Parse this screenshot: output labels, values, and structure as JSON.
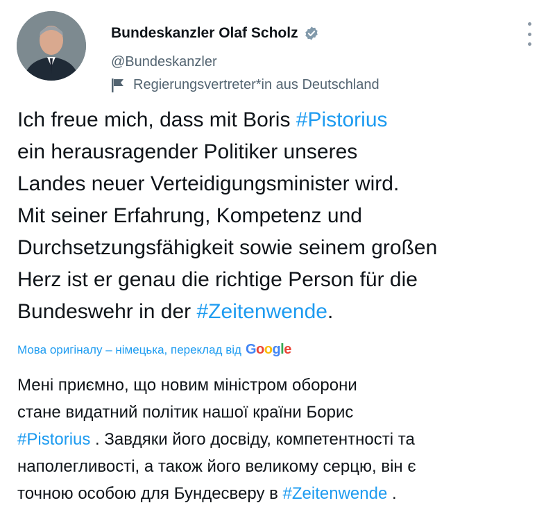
{
  "author": {
    "display_name": "Bundeskanzler Olaf Scholz",
    "handle": "@Bundeskanzler",
    "label": "Regierungsvertreter*in aus Deutschland"
  },
  "icons": {
    "verified": "verified-badge-icon",
    "flag": "government-flag-icon",
    "more": "more-vertical-icon"
  },
  "tweet": {
    "line1_before": "Ich freue mich, dass mit Boris ",
    "hashtag1": "#Pistorius",
    "middle": "\nein herausragender Politiker unseres\nLandes neuer Verteidigungsminister wird.\nMit seiner Erfahrung, Kompetenz und\nDurchsetzungsfähigkeit sowie seinem großen\nHerz ist er genau die richtige Person für die\nBundeswehr in der ",
    "hashtag2": "#Zeitenwende",
    "end": "."
  },
  "translation": {
    "notice": "Мова оригіналу – німецька, переклад від",
    "provider": "Google",
    "before": "Мені приємно, що новим міністром оборони\nстане видатний політик нашої країни Борис\n",
    "hashtag1": "#Pistorius",
    "middle": " . Завдяки його досвіду, компетентності та\nнаполегливості, а також його великому серцю, він є\nточною особою для Бундесверу в ",
    "hashtag2": "#Zeitenwende",
    "end": " ."
  },
  "colors": {
    "text": "#0f1419",
    "secondary": "#536471",
    "link": "#1d9bf0"
  }
}
